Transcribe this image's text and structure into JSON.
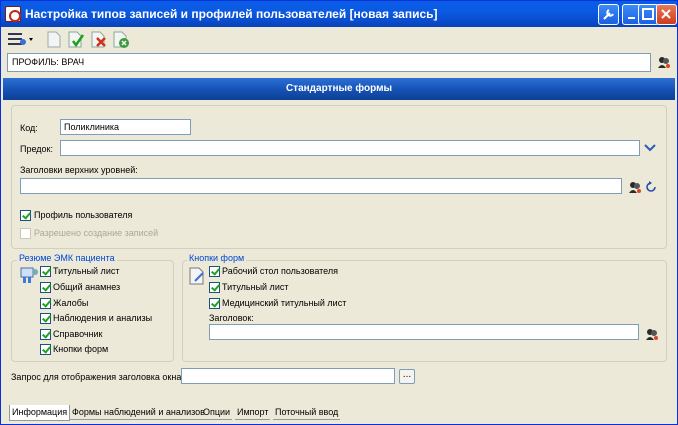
{
  "window": {
    "title": "Настройка типов записей и профилей пользователей [новая запись]",
    "buttons": [
      "help",
      "minimize",
      "maximize",
      "close"
    ]
  },
  "toolbar": {
    "tools": [
      "menu-icon",
      "document-icon",
      "save-check-icon",
      "delete-icon",
      "close-doc-icon"
    ]
  },
  "profile": {
    "value": "ПРОФИЛЬ: ВРАЧ"
  },
  "banner": {
    "title": "Стандартные формы"
  },
  "form": {
    "code_label": "Код:",
    "code_value": "Поликлиника",
    "parent_label": "Предок:",
    "parent_value": "",
    "headers_label": "Заголовки верхних уровней:",
    "headers_value": "",
    "user_profile_label": "Профиль пользователя",
    "user_profile_checked": true,
    "allow_create_label": "Разрешено создание записей",
    "allow_create_checked": false
  },
  "emk_group": {
    "legend": "Резюме ЭМК пациента",
    "items": [
      {
        "label": "Титульный лист",
        "checked": true
      },
      {
        "label": "Общий анамнез",
        "checked": true
      },
      {
        "label": "Жалобы",
        "checked": true
      },
      {
        "label": "Наблюдения и анализы",
        "checked": true
      },
      {
        "label": "Справочник",
        "checked": true
      },
      {
        "label": "Кнопки форм",
        "checked": true
      }
    ]
  },
  "buttons_group": {
    "legend": "Кнопки форм",
    "items": [
      {
        "label": "Рабочий стол пользователя",
        "checked": true
      },
      {
        "label": "Титульный лист",
        "checked": true
      },
      {
        "label": "Медицинский титульный лист",
        "checked": true
      }
    ],
    "header_label": "Заголовок:",
    "header_value": ""
  },
  "query": {
    "label": "Запрос для отображения заголовка окна:",
    "value": "",
    "button_label": "..."
  },
  "tabs": [
    {
      "label": "Информация",
      "active": true
    },
    {
      "label": "Формы наблюдений и анализов",
      "active": false
    },
    {
      "label": "Опции",
      "active": false
    },
    {
      "label": "Импорт",
      "active": false
    },
    {
      "label": "Поточный ввод",
      "active": false
    }
  ]
}
